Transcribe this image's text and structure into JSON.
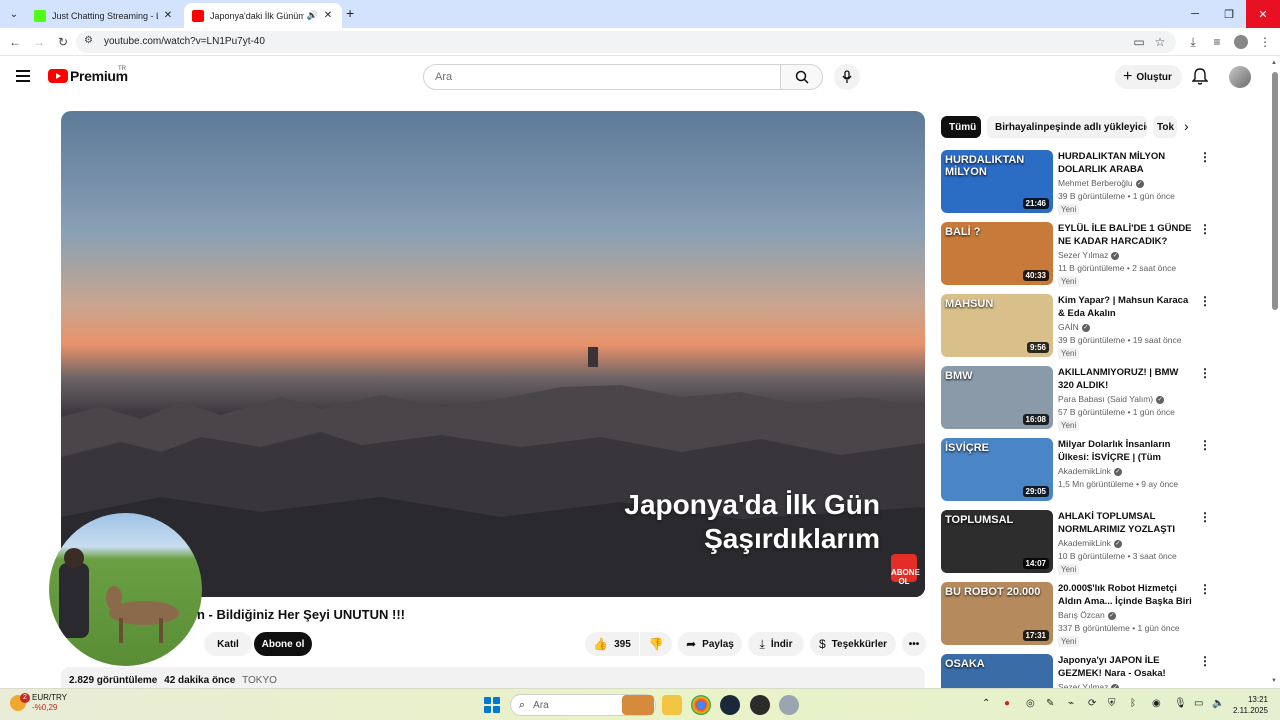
{
  "browser": {
    "tabs": [
      {
        "title": "Just Chatting Streaming - Live S",
        "active": false
      },
      {
        "title": "Japonya'daki İlk Günüm - B",
        "active": true
      }
    ],
    "url": "youtube.com/watch?v=LN1Pu7yt-40"
  },
  "masthead": {
    "logo_text": "Premium",
    "region": "TR",
    "search_placeholder": "Ara",
    "create_label": "Oluştur"
  },
  "player": {
    "overlay_line1": "Japonya'da İlk Gün",
    "overlay_line2": "Şaşırdıklarım",
    "subscribe_badge": "ABONE OL"
  },
  "video": {
    "title_visible": "n - Bildiğiniz Her Şeyi UNUTUN !!!",
    "join_label": "Katıl",
    "subscribe_label": "Abone ol",
    "like_count": "395",
    "share_label": "Paylaş",
    "download_label": "İndir",
    "thanks_label": "Teşekkürler",
    "views": "2.829 görüntüleme",
    "published": "42 dakika önce",
    "location_tag": "TOKYO"
  },
  "chips": [
    {
      "label": "Tümü",
      "active": true
    },
    {
      "label": "Birhayalinpeşinde adlı yükleyiciden",
      "active": false
    },
    {
      "label": "Tok",
      "active": false
    }
  ],
  "recommendations": [
    {
      "title": "HURDALIKTAN MİLYON DOLARLIK ARABA ALIYORUZ! ...",
      "channel": "Mehmet Berberoğlu",
      "stats": "39 B görüntüleme • 1 gün önce",
      "badge": "Yeni",
      "duration": "21:46",
      "thumb_caption": "HURDALIKTAN MİLYON",
      "thumb_color": "#2b6cc4"
    },
    {
      "title": "EYLÜL İLE BALİ'DE 1 GÜNDE NE KADAR HARCADIK?",
      "channel": "Sezer Yılmaz",
      "stats": "11 B görüntüleme • 2 saat önce",
      "badge": "Yeni",
      "duration": "40:33",
      "thumb_caption": "BALİ ?",
      "thumb_color": "#c77a3a"
    },
    {
      "title": "Kim Yapar? | Mahsun Karaca & Eda Akalın",
      "channel": "GAİN",
      "stats": "39 B görüntüleme • 19 saat önce",
      "badge": "Yeni",
      "duration": "9:56",
      "thumb_caption": "MAHSUN",
      "thumb_color": "#d9c08a"
    },
    {
      "title": "AKILLANMIYORUZ! | BMW 320 ALDIK!",
      "channel": "Para Babası (Said Yalım)",
      "stats": "57 B görüntüleme • 1 gün önce",
      "badge": "Yeni",
      "duration": "16:08",
      "thumb_caption": "BMW",
      "thumb_color": "#8a9aa8"
    },
    {
      "title": "Milyar Dolarlık İnsanların Ülkesi: İSVİÇRE | (Tüm Gerçekleriyle!)",
      "channel": "AkademikLink",
      "stats": "1,5 Mn görüntüleme • 9 ay önce",
      "badge": "",
      "duration": "29:05",
      "thumb_caption": "İSVİÇRE",
      "thumb_color": "#4a86c5"
    },
    {
      "title": "AHLAKİ TOPLUMSAL NORMLARIMIZ YOZLAŞTI MI?",
      "channel": "AkademikLink",
      "stats": "10 B görüntüleme • 3 saat önce",
      "badge": "Yeni",
      "duration": "14:07",
      "thumb_caption": "TOPLUMSAL",
      "thumb_color": "#2d2d2d"
    },
    {
      "title": "20.000$'lık Robot Hizmetçi Aldın Ama... İçinde Başka Biri ...",
      "channel": "Barış Özcan",
      "stats": "337 B görüntüleme • 1 gün önce",
      "badge": "Yeni",
      "duration": "17:31",
      "thumb_caption": "BU ROBOT 20.000",
      "thumb_color": "#b58a5c"
    },
    {
      "title": "Japonya'yı JAPON İLE GEZMEK! Nara - Osaka!",
      "channel": "Sezer Yılmaz",
      "stats": "",
      "badge": "",
      "duration": "",
      "thumb_caption": "OSAKA",
      "thumb_color": "#3a6da8"
    }
  ],
  "taskbar": {
    "widget_badge": "2",
    "widget_title": "EUR/TRY",
    "widget_value": "-%0,29",
    "search_placeholder": "Ara",
    "time": "13:21",
    "date": "2.11.2025"
  }
}
